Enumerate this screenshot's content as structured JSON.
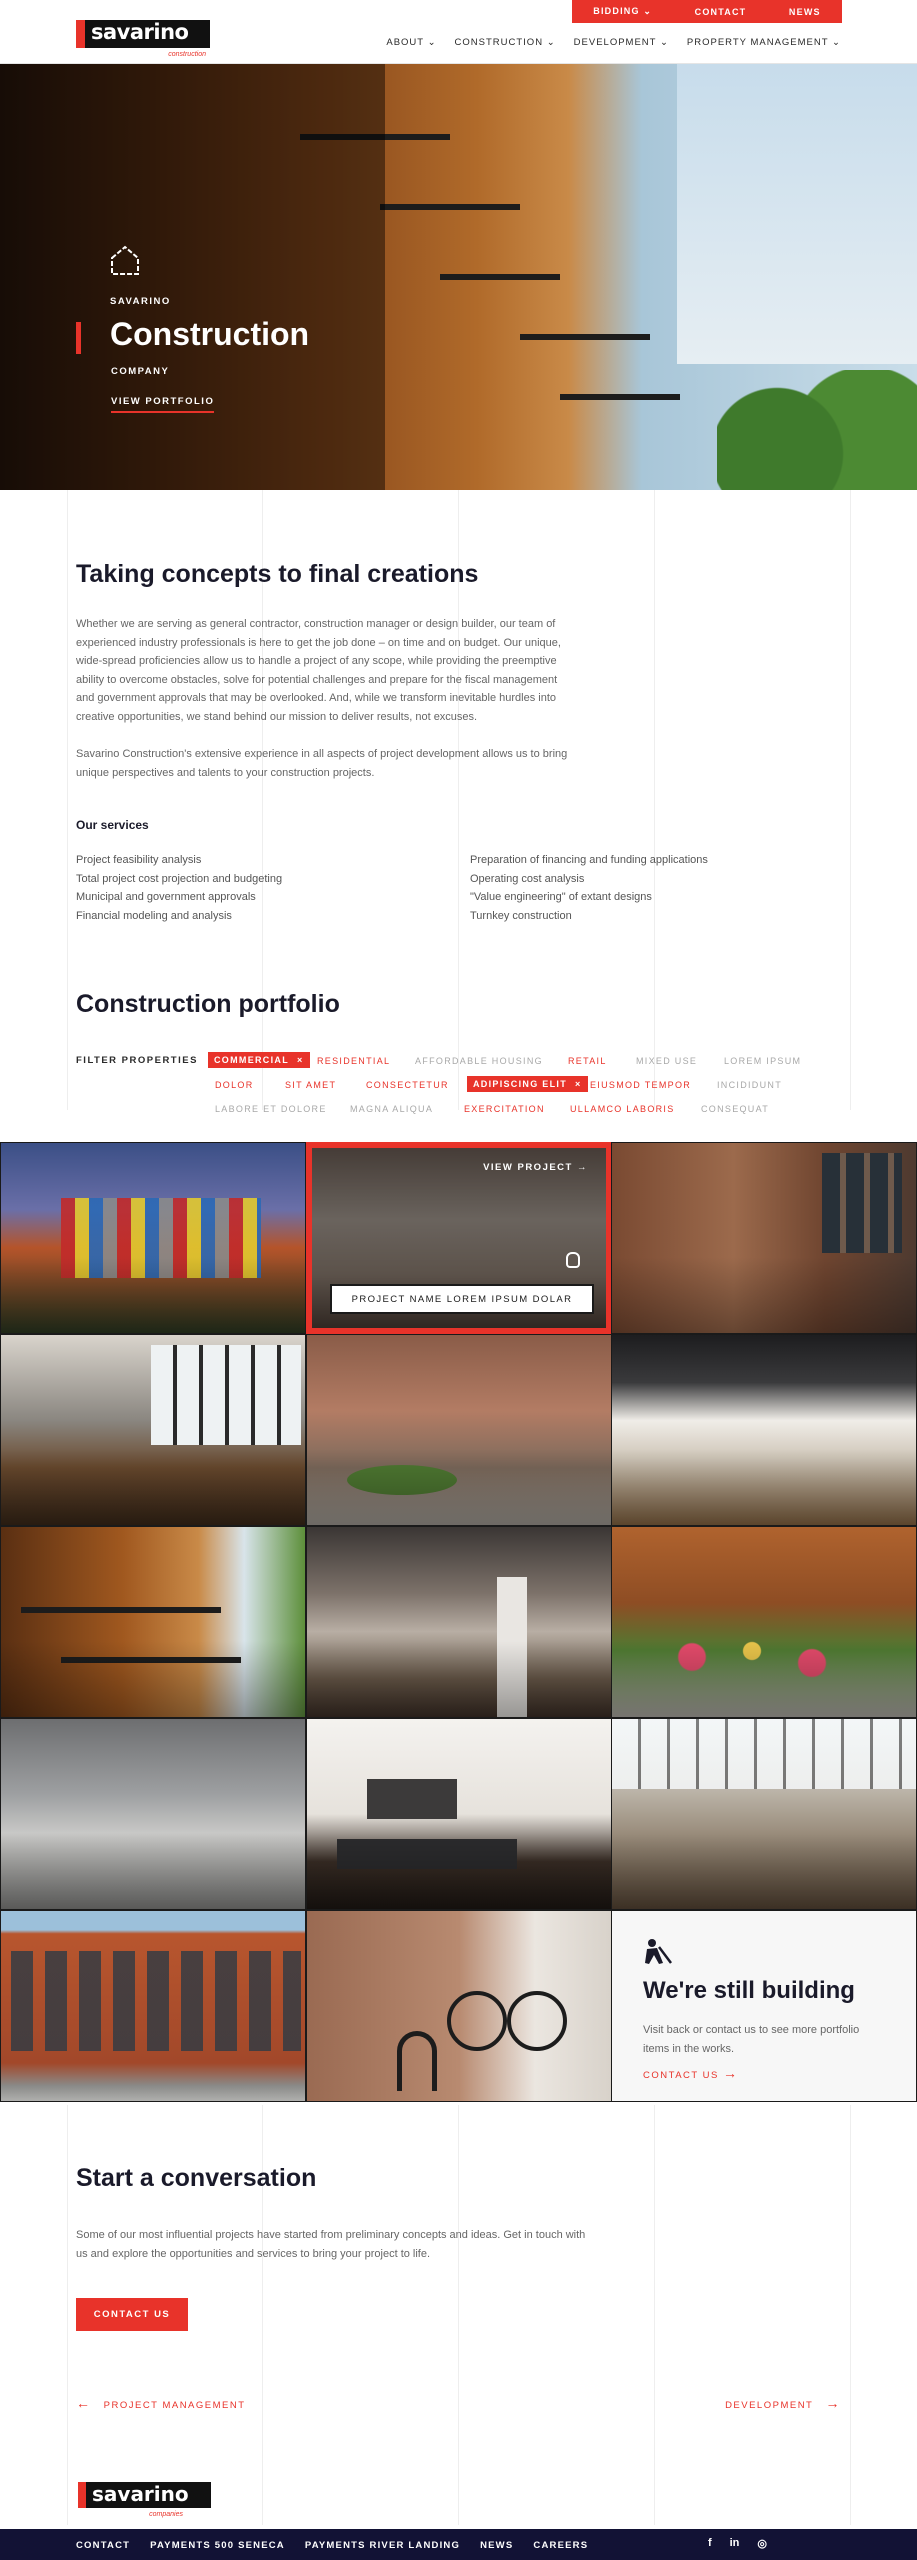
{
  "header": {
    "logo_text": "savarino",
    "logo_sub": "construction",
    "topbar": [
      "BIDDING",
      "CONTACT",
      "NEWS"
    ],
    "nav": [
      "ABOUT",
      "CONSTRUCTION",
      "DEVELOPMENT",
      "PROPERTY MANAGEMENT"
    ]
  },
  "hero": {
    "eyebrow": "SAVARINO",
    "title": "Construction",
    "subtitle": "COMPANY",
    "link": "VIEW PORTFOLIO"
  },
  "intro": {
    "title": "Taking concepts to final creations",
    "para1": "Whether we are serving as general contractor, construction manager or design builder, our team of experienced industry professionals is here to get the job done – on time and on budget. Our unique, wide-spread proficiencies allow us to handle a project of any scope, while providing the preemptive ability to overcome obstacles, solve for potential challenges and prepare for the fiscal management and government approvals that may be overlooked. And, while we transform inevitable hurdles into creative opportunities, we stand behind our mission to deliver results, not excuses.",
    "para2": "Savarino Construction's extensive experience in all aspects of project development allows us to bring unique perspectives and talents to your construction projects."
  },
  "services": {
    "title": "Our services",
    "left": [
      "Project feasibility analysis",
      "Total project cost projection and budgeting",
      "Municipal and government approvals",
      "Financial modeling and analysis"
    ],
    "right": [
      "Preparation of financing and funding applications",
      "Operating cost analysis",
      "\"Value engineering\" of extant designs",
      "Turnkey construction"
    ]
  },
  "portfolio": {
    "title": "Construction portfolio",
    "filter_label": "FILTER PROPERTIES",
    "filters_row1": [
      "COMMERCIAL",
      "RESIDENTIAL",
      "AFFORDABLE HOUSING",
      "RETAIL",
      "MIXED USE",
      "LOREM IPSUM"
    ],
    "filters_row2": [
      "DOLOR",
      "SIT AMET",
      "CONSECTETUR",
      "ADIPISCING ELIT",
      "EIUSMOD TEMPOR",
      "INCIDIDUNT"
    ],
    "filters_row3": [
      "LABORE ET DOLORE",
      "MAGNA ALIQUA",
      "EXERCITATION",
      "ULLAMCO LABORIS",
      "CONSEQUAT"
    ],
    "view_project": "VIEW PROJECT",
    "hover_name": "PROJECT NAME LOREM IPSUM DOLAR",
    "building_title": "We're still building",
    "building_text": "Visit back or contact us to see more portfolio items in the works.",
    "building_link": "CONTACT US"
  },
  "conversation": {
    "title": "Start a conversation",
    "text": "Some of our most influential projects have started from preliminary concepts and ideas. Get in touch with us and explore the opportunities and services to bring your project to life.",
    "cta": "CONTACT US",
    "prev": "PROJECT MANAGEMENT",
    "next": "DEVELOPMENT"
  },
  "footer": {
    "logo_text": "savarino",
    "logo_sub": "companies",
    "links": [
      "CONTACT",
      "PAYMENTS 500 SENECA",
      "PAYMENTS RIVER LANDING",
      "NEWS",
      "CAREERS"
    ],
    "social": [
      "f",
      "in",
      "◎"
    ]
  },
  "colors": {
    "accent": "#e8332a",
    "dark": "#121235"
  }
}
